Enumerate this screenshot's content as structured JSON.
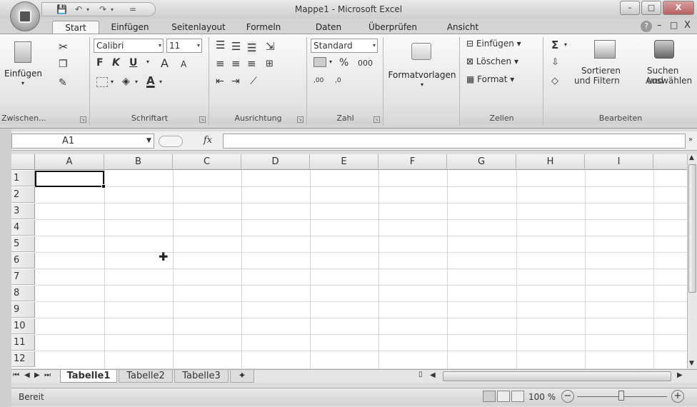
{
  "window": {
    "title": "Mappe1 - Microsoft Excel",
    "minimize": "–",
    "restore": "□",
    "close": "X"
  },
  "qat": {
    "save": "💾",
    "undo": "↶",
    "redo": "↷",
    "customize": "="
  },
  "tabs": [
    "Start",
    "Einfügen",
    "Seitenlayout",
    "Formeln",
    "Daten",
    "Überprüfen",
    "Ansicht"
  ],
  "ribbon_right": {
    "help": "?",
    "minimize": "–",
    "restore": "□",
    "close": "X"
  },
  "ribbon": {
    "clipboard": {
      "label": "Zwischen...",
      "paste": "Einfügen"
    },
    "font": {
      "label": "Schriftart",
      "font_name": "Calibri",
      "font_size": "11",
      "bold": "F",
      "italic": "K",
      "underline": "U",
      "grow": "A",
      "shrink": "A",
      "color": "A"
    },
    "alignment": {
      "label": "Ausrichtung"
    },
    "number": {
      "label": "Zahl",
      "format": "Standard",
      "percent": "%",
      "thousands": "000",
      "inc_decimal": ",00",
      "dec_decimal": ",0"
    },
    "styles": {
      "label": "Formatvorlagen"
    },
    "cells": {
      "label": "Zellen",
      "insert": "Einfügen",
      "delete": "Löschen",
      "format": "Format"
    },
    "editing": {
      "label": "Bearbeiten",
      "sum": "Σ",
      "sort": "Sortieren",
      "sort2": "und Filtern",
      "find": "Suchen und",
      "find2": "Auswählen"
    }
  },
  "formula_bar": {
    "name_box": "A1",
    "fx": "fx",
    "value": ""
  },
  "columns": [
    "A",
    "B",
    "C",
    "D",
    "E",
    "F",
    "G",
    "H",
    "I"
  ],
  "rows": [
    "1",
    "2",
    "3",
    "4",
    "5",
    "6",
    "7",
    "8",
    "9",
    "10",
    "11",
    "12"
  ],
  "sheets": {
    "active": "Tabelle1",
    "others": [
      "Tabelle2",
      "Tabelle3"
    ]
  },
  "status": {
    "ready": "Bereit",
    "zoom": "100 %",
    "zoom_out": "−",
    "zoom_in": "+"
  }
}
